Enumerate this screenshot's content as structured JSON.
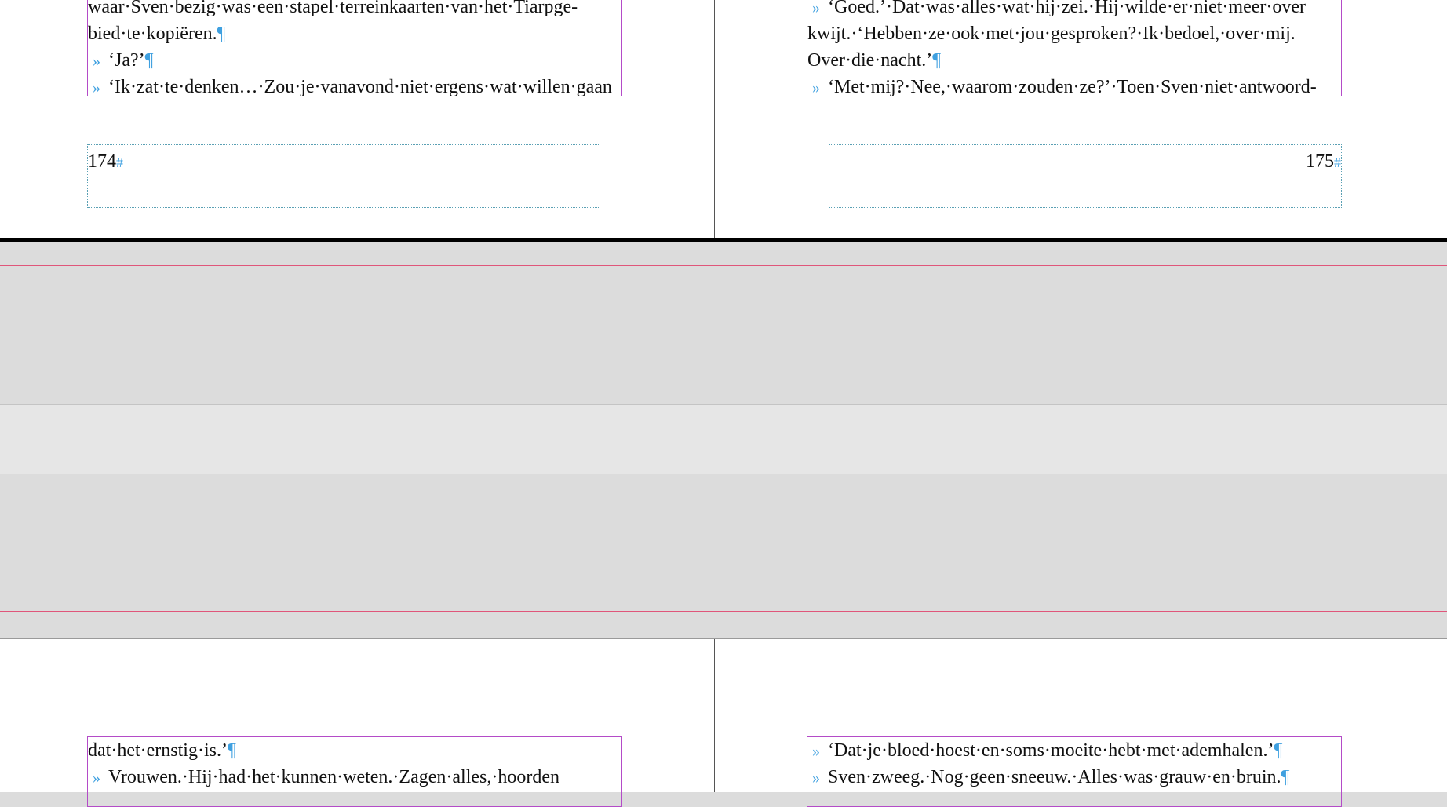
{
  "spread_top": {
    "left_page": {
      "lines": [
        {
          "quote": false,
          "text": "waar·Sven·bezig·was·een·stapel·terreinkaarten·van·het·Tiarpge-",
          "pilcrow": false
        },
        {
          "quote": false,
          "text": "bied·te·kopiëren.",
          "pilcrow": true
        },
        {
          "quote": true,
          "text": "‘Ja?’",
          "pilcrow": true
        },
        {
          "quote": true,
          "text": "‘Ik·zat·te·denken…·Zou·je·vanavond·niet·ergens·wat·willen·gaan",
          "pilcrow": false
        }
      ],
      "folio": "174",
      "folio_marker": "#"
    },
    "right_page": {
      "lines": [
        {
          "quote": true,
          "text": "‘Goed.’·Dat·was·alles·wat·hij·zei.·Hij·wilde·er·niet·meer·over",
          "pilcrow": false
        },
        {
          "quote": false,
          "text": "kwijt.·‘Hebben·ze·ook·met·jou·gesproken?·Ik·bedoel,·over·mij.",
          "pilcrow": false
        },
        {
          "quote": false,
          "text": "Over·die·nacht.’",
          "pilcrow": true
        },
        {
          "quote": true,
          "text": "‘Met·mij?·Nee,·waarom·zouden·ze?’·Toen·Sven·niet·antwoord-",
          "pilcrow": false
        }
      ],
      "folio": "175",
      "folio_marker": "#"
    }
  },
  "spread_bottom": {
    "left_page": {
      "lines": [
        {
          "quote": false,
          "text": "dat·het·ernstig·is.’",
          "pilcrow": true
        },
        {
          "quote": true,
          "text": "Vrouwen.·Hij·had·het·kunnen·weten.·Zagen·alles,·hoorden",
          "pilcrow": false
        }
      ]
    },
    "right_page": {
      "lines": [
        {
          "quote": true,
          "text": "‘Dat·je·bloed·hoest·en·soms·moeite·hebt·met·ademhalen.’",
          "pilcrow": true
        },
        {
          "quote": true,
          "text": "Sven·zweeg.·Nog·geen·sneeuw.·Alles·was·grauw·en·bruin.",
          "pilcrow": true
        }
      ]
    }
  },
  "glyphs": {
    "pilcrow": "¶",
    "quote_marker": "»"
  },
  "colors": {
    "pasteboard": "#dcdcdc",
    "frame_border": "#b44bc8",
    "folio_border": "#5aa0b4",
    "hidden_chars": "#3fa0e0",
    "bleed_guide": "#e0567a"
  }
}
